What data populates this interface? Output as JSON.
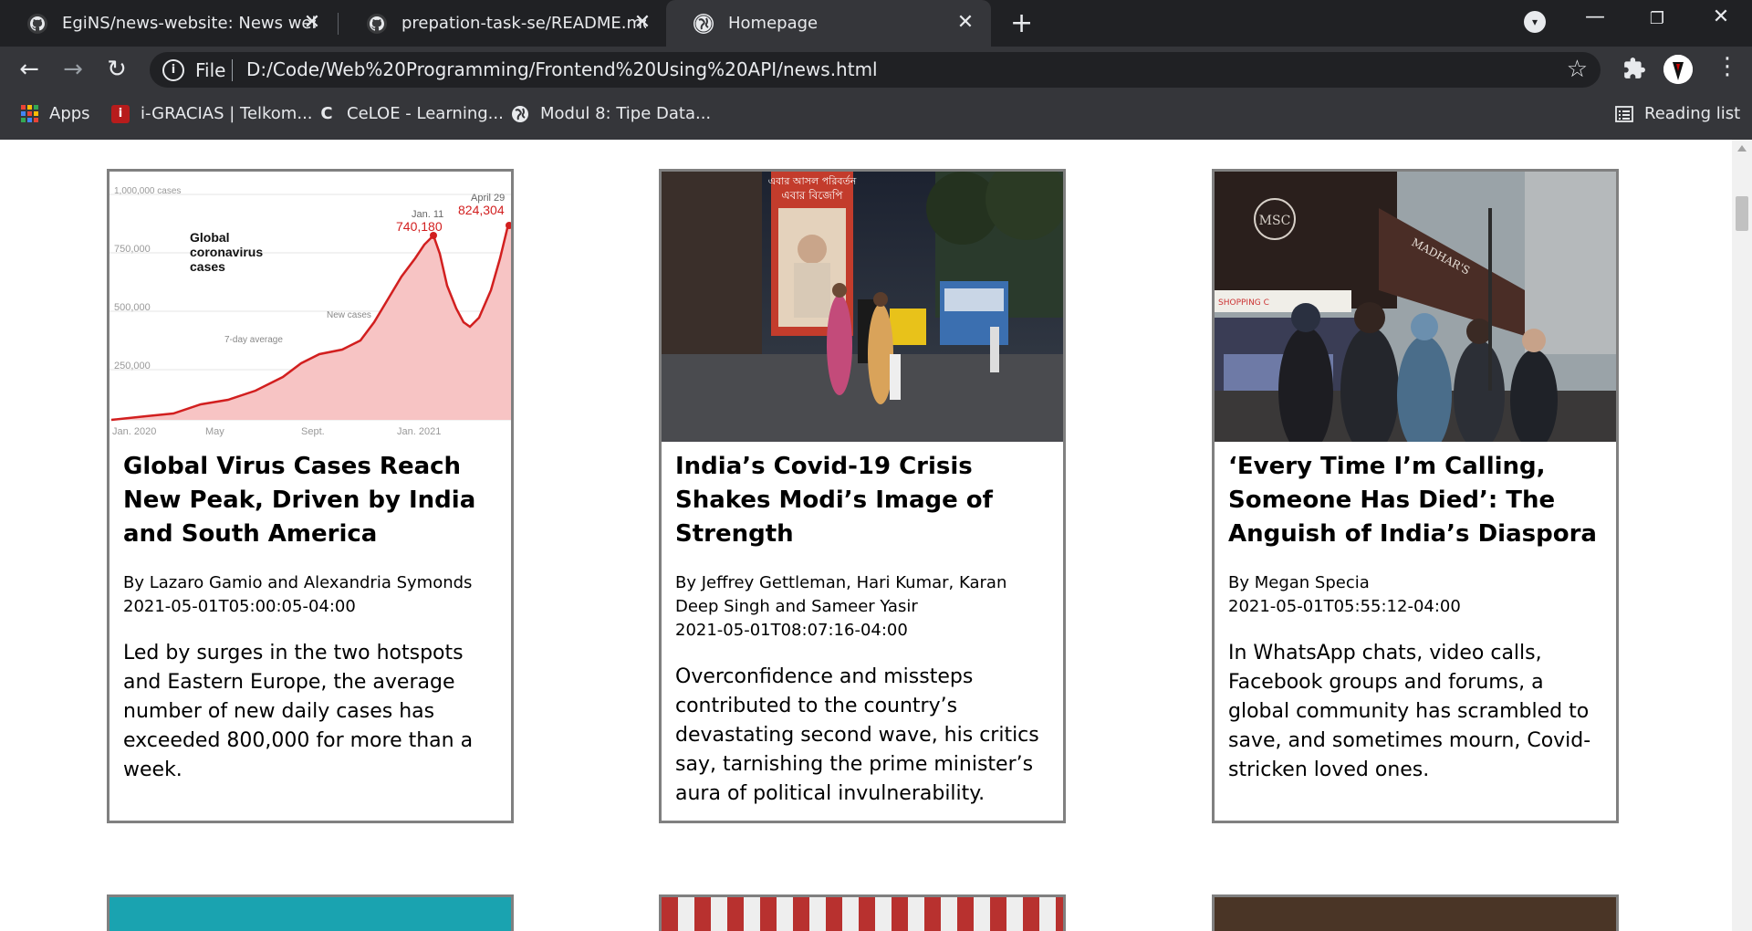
{
  "browser": {
    "tabs": [
      {
        "title": "EgiNS/news-website: News websi",
        "favicon": "github-icon",
        "active": false
      },
      {
        "title": "prepation-task-se/README.md a",
        "favicon": "github-icon",
        "active": false
      },
      {
        "title": "Homepage",
        "favicon": "globe-icon",
        "active": true
      }
    ],
    "url_scheme_label": "File",
    "url": "D:/Code/Web%20Programming/Frontend%20Using%20API/news.html",
    "bookmarks": [
      {
        "label": "Apps",
        "icon": "apps-grid-icon"
      },
      {
        "label": "i-GRACIAS | Telkom...",
        "icon": "telkom-icon"
      },
      {
        "label": "CeLOE - Learning...",
        "icon": "celoe-icon"
      },
      {
        "label": "Modul 8: Tipe Data...",
        "icon": "globe-icon"
      }
    ],
    "reading_list_label": "Reading list"
  },
  "articles": [
    {
      "title": "Global Virus Cases Reach New Peak, Driven by India and South America",
      "author": "By Lazaro Gamio and Alexandria Symonds",
      "date": "2021-05-01T05:00:05-04:00",
      "description": "Led by surges in the two hotspots and Eastern Europe, the average number of new daily cases has exceeded 800,000 for more than a week.",
      "image": "coronavirus-cases-chart-image"
    },
    {
      "title": "India’s Covid-19 Crisis Shakes Modi’s Image of Strength",
      "author": "By Jeffrey Gettleman, Hari Kumar, Karan Deep Singh and Sameer Yasir",
      "date": "2021-05-01T08:07:16-04:00",
      "description": "Overconfidence and missteps contributed to the country’s devastating second wave, his critics say, tarnishing the prime minister’s aura of political invulnerability.",
      "image": "india-street-photo"
    },
    {
      "title": "‘Every Time I’m Calling, Someone Has Died’: The Anguish of India’s Diaspora",
      "author": "By Megan Specia",
      "date": "2021-05-01T05:55:12-04:00",
      "description": "In WhatsApp chats, video calls, Facebook groups and forums, a global community has scrambled to save, and sometimes mourn, Covid-stricken loved ones.",
      "image": "diaspora-street-photo"
    }
  ],
  "chart_thumbnail": {
    "title": "Global coronavirus cases",
    "y_ticks": [
      "1,000,000 cases",
      "750,000",
      "500,000",
      "250,000"
    ],
    "x_ticks": [
      "Jan. 2020",
      "May",
      "Sept.",
      "Jan. 2021"
    ],
    "annotations": {
      "peak1_label": "Jan. 11",
      "peak1_value": "740,180",
      "peak2_label": "April 29",
      "peak2_value": "824,304",
      "new_cases_label": "New cases",
      "avg_label": "7-day average"
    }
  },
  "photo_text": {
    "poster_line1": "এবার আসল পরিবর্তন",
    "poster_line2": "এবার বিজেপি",
    "shop_sign": "MADHAR'S",
    "shop_logo": "MSC",
    "shop_awning": "SHOPPING C"
  }
}
